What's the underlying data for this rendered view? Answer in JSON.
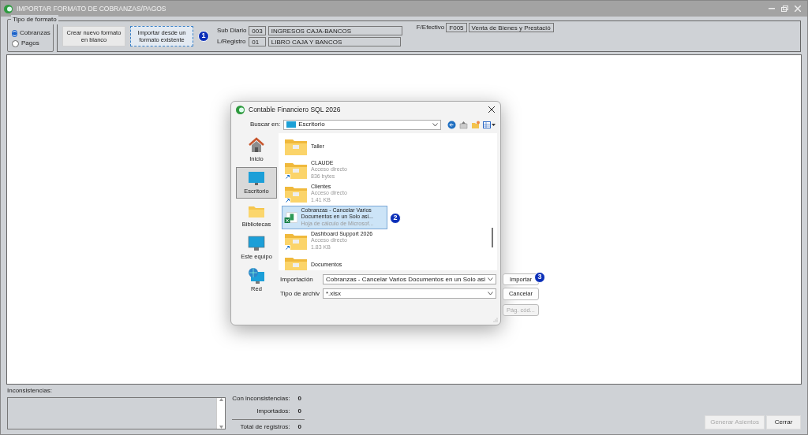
{
  "window": {
    "title": "IMPORTAR FORMATO DE COBRANZAS/PAGOS"
  },
  "format_type": {
    "legend": "Tipo de formato",
    "options": [
      {
        "label": "Cobranzas",
        "selected": true
      },
      {
        "label": "Pagos",
        "selected": false
      }
    ]
  },
  "toolbar": {
    "buttons": [
      {
        "label": "Crear nuevo formato en blanco",
        "focused": false
      },
      {
        "label": "Importar desde un formato existente",
        "focused": true,
        "step": "1"
      }
    ],
    "sub_diario": {
      "label": "Sub Diario",
      "code": "003",
      "name": "INGRESOS CAJA-BANCOS"
    },
    "l_registro": {
      "label": "L/Registro",
      "code": "01",
      "name": "LIBRO CAJA Y BANCOS"
    },
    "f_efectivo": {
      "label": "F/Efectivo",
      "code": "F005",
      "name": "Venta de Bienes y Prestació"
    }
  },
  "dialog": {
    "title": "Contable Financiero SQL 2026",
    "look_in_label": "Buscar en:",
    "look_in_value": "Escritorio",
    "places": [
      {
        "label": "Inicio",
        "kind": "home",
        "selected": false
      },
      {
        "label": "Escritorio",
        "kind": "desktop",
        "selected": true
      },
      {
        "label": "Bibliotecas",
        "kind": "folder",
        "selected": false
      },
      {
        "label": "Este equipo",
        "kind": "computer",
        "selected": false
      },
      {
        "label": "Red",
        "kind": "network",
        "selected": false
      }
    ],
    "files": [
      {
        "name": "Taller",
        "kind": "folder",
        "shortcut": false,
        "selected": false
      },
      {
        "name": "CLAUDE",
        "kind": "folder",
        "shortcut": true,
        "details": [
          "Acceso directo",
          "836 bytes"
        ],
        "selected": false
      },
      {
        "name": "Clientes",
        "kind": "folder",
        "shortcut": true,
        "details": [
          "Acceso directo",
          "1.41 KB"
        ],
        "selected": false
      },
      {
        "name": "Cobranzas - Cancelar Varios Documentos en un Solo asi...",
        "kind": "excel",
        "shortcut": false,
        "details": [
          "Hoja de cálculo de Microsof..."
        ],
        "selected": true,
        "step": "2"
      },
      {
        "name": "Dashboard Support 2026",
        "kind": "folder",
        "shortcut": true,
        "details": [
          "Acceso directo",
          "1.83 KB"
        ],
        "selected": false
      },
      {
        "name": "Documentos",
        "kind": "folder",
        "shortcut": false,
        "selected": false
      }
    ],
    "file_name_label": "Importación",
    "file_name_value": "Cobranzas - Cancelar Varios Documentos en un Solo asi",
    "file_type_label": "Tipo de archiv",
    "file_type_value": "*.xlsx",
    "buttons": [
      {
        "label": "Importar",
        "disabled": false,
        "step": "3"
      },
      {
        "label": "Cancelar",
        "disabled": false
      },
      {
        "label": "Pág. cód...",
        "disabled": true
      }
    ]
  },
  "inconsistencies_label": "Inconsistencias:",
  "stats": [
    {
      "label": "Con inconsistencias:",
      "value": "0"
    },
    {
      "label": "Importados:",
      "value": "0"
    },
    {
      "label": "Total de registros:",
      "value": "0"
    }
  ],
  "footer_buttons": [
    {
      "label": "Generar Asientos",
      "disabled": true
    },
    {
      "label": "Cerrar",
      "disabled": false
    }
  ]
}
